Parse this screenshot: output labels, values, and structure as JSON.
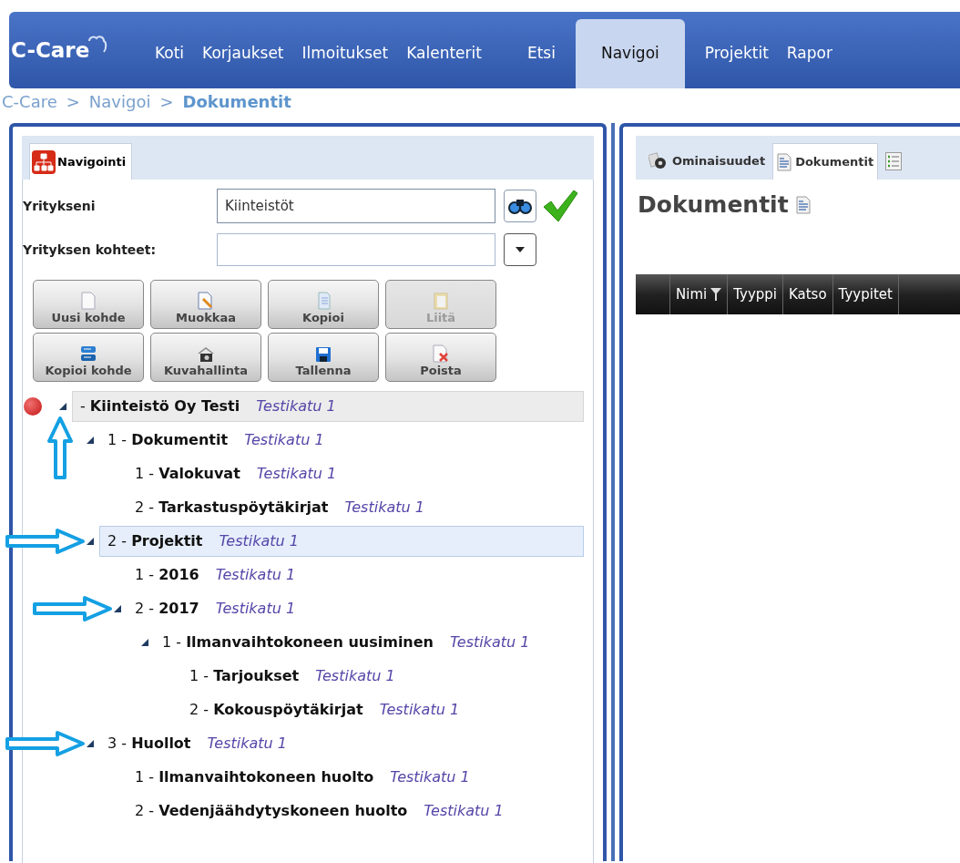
{
  "logo": "C-Care",
  "nav": [
    {
      "label": "Koti",
      "selected": false
    },
    {
      "label": "Korjaukset",
      "selected": false
    },
    {
      "label": "Ilmoitukset",
      "selected": false
    },
    {
      "label": "Kalenterit",
      "selected": false
    },
    {
      "label": "Etsi",
      "selected": false
    },
    {
      "label": "Navigoi",
      "selected": true
    },
    {
      "label": "Projektit",
      "selected": false
    },
    {
      "label": "Rapor",
      "selected": false
    }
  ],
  "breadcrumb": [
    {
      "label": "C-Care",
      "current": false
    },
    {
      "label": "Navigoi",
      "current": false
    },
    {
      "label": "Dokumentit",
      "current": true
    }
  ],
  "breadcrumb_separator": ">",
  "left_panel": {
    "tab": {
      "label": "Navigointi",
      "selected": true
    },
    "company": {
      "label": "Yritykseni",
      "value": "Kiinteistöt"
    },
    "targets": {
      "label": "Yrityksen kohteet:"
    },
    "buttons": [
      {
        "label": "Uusi kohde",
        "disabled": false
      },
      {
        "label": "Muokkaa",
        "disabled": false
      },
      {
        "label": "Kopioi",
        "disabled": false
      },
      {
        "label": "Liitä",
        "disabled": true
      },
      {
        "label": "Kopioi kohde",
        "disabled": false
      },
      {
        "label": "Kuvahallinta",
        "disabled": false
      },
      {
        "label": "Tallenna",
        "disabled": false
      },
      {
        "label": "Poista",
        "disabled": false
      }
    ],
    "tree": [
      {
        "label": "- **Kiinteistö Oy Testi**",
        "address": "Testikatu 1",
        "kind": "root",
        "expanded": true,
        "selected": false,
        "marked": true,
        "children": [
          {
            "label": "1 - **Dokumentit**",
            "address": "Testikatu 1",
            "kind": "node",
            "expanded": true,
            "selected": false,
            "marked": false,
            "children": [
              {
                "label": "1 - **Valokuvat**",
                "address": "Testikatu 1",
                "kind": "node",
                "selected": false,
                "marked": false
              },
              {
                "label": "2 - **Tarkastuspöytäkirjat**",
                "address": "Testikatu 1",
                "kind": "node",
                "selected": false,
                "marked": false
              }
            ]
          },
          {
            "label": "2 - **Projektit**",
            "address": "Testikatu 1",
            "kind": "node",
            "expanded": true,
            "selected": true,
            "marked": true,
            "children": [
              {
                "label": "1 - **2016**",
                "address": "Testikatu 1",
                "kind": "node",
                "selected": false,
                "marked": false
              },
              {
                "label": "2 - **2017**",
                "address": "Testikatu 1",
                "kind": "node",
                "expanded": true,
                "selected": false,
                "marked": true,
                "children": [
                  {
                    "label": "1 - **Ilmanvaihtokoneen uusiminen**",
                    "address": "Testikatu 1",
                    "kind": "node",
                    "expanded": true,
                    "selected": false,
                    "marked": false,
                    "children": [
                      {
                        "label": "1 - **Tarjoukset**",
                        "address": "Testikatu 1",
                        "kind": "node",
                        "selected": false,
                        "marked": false
                      },
                      {
                        "label": "2 - **Kokouspöytäkirjat**",
                        "address": "Testikatu 1",
                        "kind": "node",
                        "selected": false,
                        "marked": false
                      }
                    ]
                  }
                ]
              }
            ]
          },
          {
            "label": "3 - **Huollot**",
            "address": "Testikatu 1",
            "kind": "node",
            "expanded": true,
            "selected": false,
            "marked": true,
            "children": [
              {
                "label": "1 - **Ilmanvaihtokoneen huolto**",
                "address": "Testikatu 1",
                "kind": "node",
                "selected": false,
                "marked": false
              },
              {
                "label": "2 - **Vedenjäähdytyskoneen huolto**",
                "address": "Testikatu 1",
                "kind": "node",
                "selected": false,
                "marked": false
              }
            ]
          }
        ]
      }
    ]
  },
  "right_panel": {
    "tabs": [
      {
        "label": "Ominaisuudet",
        "selected": false
      },
      {
        "label": "Dokumentit",
        "selected": true
      },
      {
        "selected": false
      }
    ],
    "heading": "Dokumentit",
    "table": {
      "columns": [
        {
          "filter": false
        },
        {
          "label": "Nimi",
          "filter": true
        },
        {
          "label": "Tyyppi",
          "filter": false
        },
        {
          "label": "Katso",
          "filter": false
        },
        {
          "label": "Tyypitet",
          "filter": false
        }
      ]
    }
  }
}
